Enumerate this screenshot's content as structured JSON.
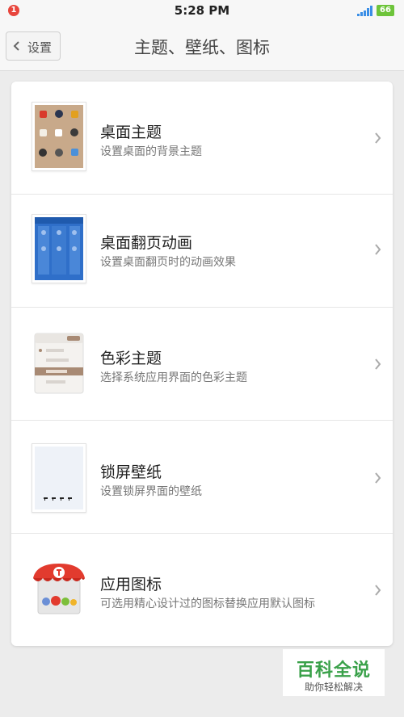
{
  "status_bar": {
    "notification_count": "1",
    "time": "5:28 PM",
    "battery": "66"
  },
  "nav": {
    "back_label": "设置",
    "title": "主题、壁纸、图标"
  },
  "items": [
    {
      "title": "桌面主题",
      "description": "设置桌面的背景主题",
      "icon": "desktop-theme-thumbnail"
    },
    {
      "title": "桌面翻页动画",
      "description": "设置桌面翻页时的动画效果",
      "icon": "page-flip-animation-thumbnail"
    },
    {
      "title": "色彩主题",
      "description": "选择系统应用界面的色彩主题",
      "icon": "color-theme-thumbnail"
    },
    {
      "title": "锁屏壁纸",
      "description": "设置锁屏界面的壁纸",
      "icon": "lockscreen-wallpaper-thumbnail"
    },
    {
      "title": "应用图标",
      "description": "可选用精心设计过的图标替换应用默认图标",
      "icon": "app-icon-store-thumbnail"
    }
  ],
  "watermark": {
    "title": "百科全说",
    "subtitle": "助你轻松解决"
  },
  "colors": {
    "accent_green": "#3aa14a",
    "badge_red": "#e8453c",
    "battery_green": "#6dc43a",
    "flip_blue": "#2f6fc9",
    "theme_tan": "#c8a98a"
  }
}
